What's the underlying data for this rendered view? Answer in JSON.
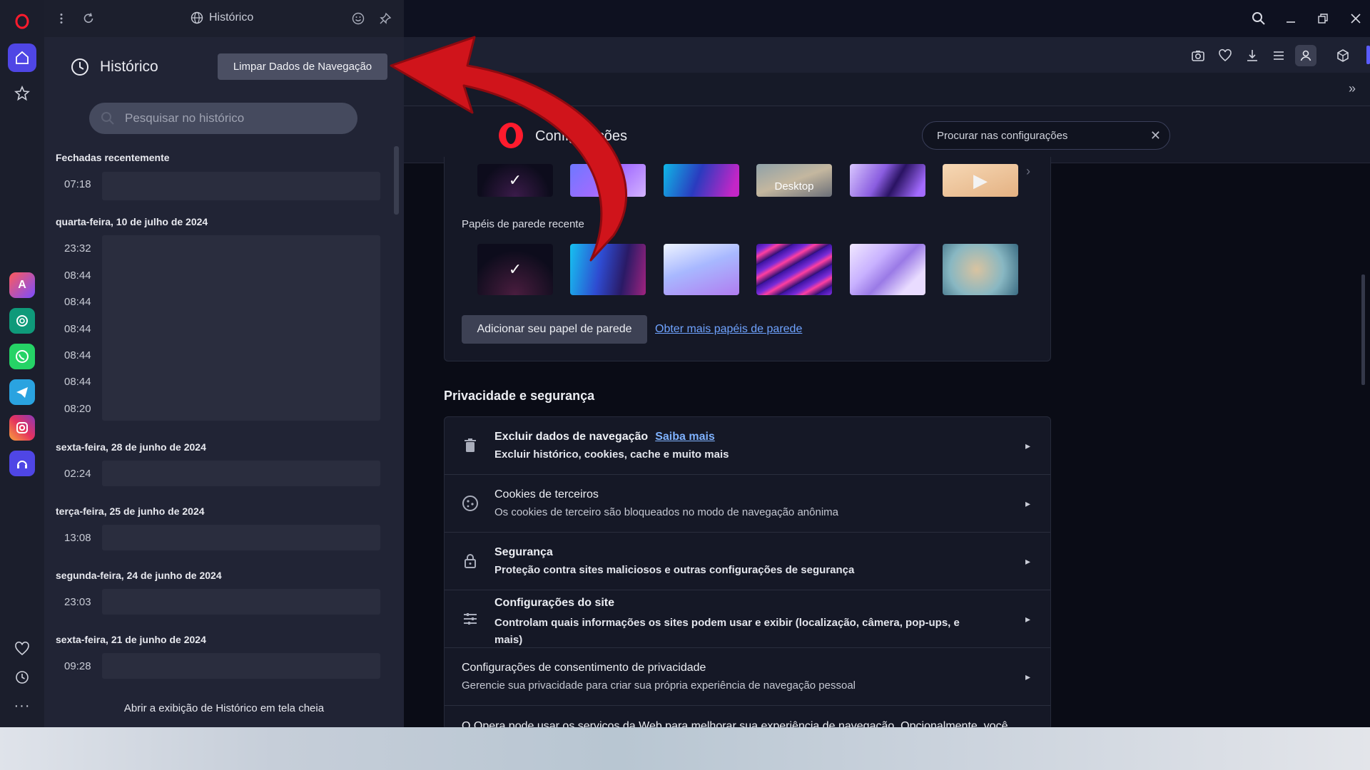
{
  "history_panel": {
    "header_title": "Histórico",
    "title": "Histórico",
    "clear_button": "Limpar Dados de Navegação",
    "search_placeholder": "Pesquisar no histórico",
    "sections": [
      {
        "heading": "Fechadas recentemente",
        "times": [
          "07:18"
        ]
      },
      {
        "heading": "quarta-feira, 10 de julho de 2024",
        "times": [
          "23:32",
          "08:44",
          "08:44",
          "08:44",
          "08:44",
          "08:44",
          "08:20"
        ]
      },
      {
        "heading": "sexta-feira, 28 de junho de 2024",
        "times": [
          "02:24"
        ]
      },
      {
        "heading": "terça-feira, 25 de junho de 2024",
        "times": [
          "13:08"
        ]
      },
      {
        "heading": "segunda-feira, 24 de junho de 2024",
        "times": [
          "23:03"
        ]
      },
      {
        "heading": "sexta-feira, 21 de junho de 2024",
        "times": [
          "09:28"
        ]
      }
    ],
    "open_full": "Abrir a exibição de Histórico em tela cheia"
  },
  "settings": {
    "title": "Configurações",
    "search_placeholder": "Procurar nas configurações",
    "wallpaper_desktop_label": "Desktop",
    "recent_wallpapers_label": "Papéis de parede recente",
    "add_wallpaper": "Adicionar seu papel de parede",
    "more_wallpapers": "Obter mais papéis de parede",
    "privacy_title": "Privacidade e segurança",
    "privacy_rows": [
      {
        "title": "Excluir dados de navegação",
        "link": "Saiba mais",
        "sub": "Excluir histórico, cookies, cache e muito mais",
        "icon": "trash-icon"
      },
      {
        "title": "Cookies de terceiros",
        "sub": "Os cookies de terceiro são bloqueados no modo de navegação anônima",
        "icon": "cookie-icon"
      },
      {
        "title": "Segurança",
        "sub": "Proteção contra sites maliciosos e outras configurações de segurança",
        "icon": "lock-icon"
      },
      {
        "title": "Configurações do site",
        "sub": "Controlam quais informações os sites podem usar e exibir (localização, câmera, pop-ups, e mais)",
        "icon": "sliders-icon"
      },
      {
        "title": "Configurações de consentimento de privacidade",
        "sub": "Gerencie sua privacidade para criar sua própria experiência de navegação pessoal",
        "icon": ""
      },
      {
        "title": "O Opera pode usar os serviços da Web para melhorar sua experiência de navegação. Opcionalmente, você",
        "sub": "",
        "icon": ""
      }
    ]
  },
  "colors": {
    "opera_red": "#ff1b2d",
    "accent_blue": "#5a5cff",
    "link_blue": "#7fb2ff",
    "annotation_red": "#d0141b"
  }
}
